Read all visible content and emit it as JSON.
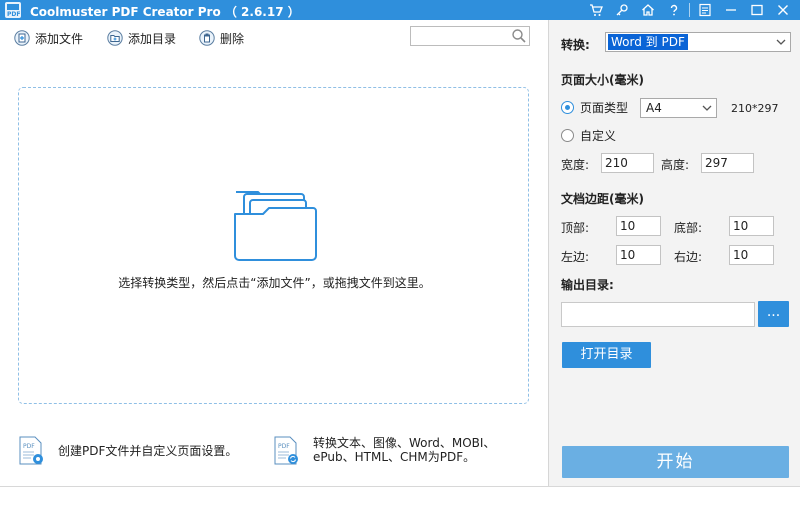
{
  "titlebar": {
    "title": "Coolmuster PDF Creator Pro （ 2.6.17 ）",
    "logo_text": "PDF",
    "icons": [
      "cart-icon",
      "key-icon",
      "home-icon",
      "help-icon",
      "feedback-icon",
      "minimize-icon",
      "maximize-icon",
      "close-icon"
    ]
  },
  "toolbar": {
    "add_file_label": "添加文件",
    "add_folder_label": "添加目录",
    "delete_label": "删除",
    "search_placeholder": ""
  },
  "dropzone": {
    "hint": "选择转换类型，然后点击“添加文件”，或拖拽文件到这里。"
  },
  "features": [
    {
      "icon": "pdf-settings-icon",
      "lines": [
        "创建PDF文件并自定义页面设置。"
      ]
    },
    {
      "icon": "pdf-convert-icon",
      "lines": [
        "转换文本、图像、Word、MOBI、",
        "ePub、HTML、CHM为PDF。"
      ]
    }
  ],
  "panel": {
    "convert_label": "转换:",
    "convert_value": "Word 到 PDF",
    "page_size_heading": "页面大小(毫米)",
    "page_type_label": "页面类型",
    "page_type_value": "A4",
    "page_type_dims": "210*297",
    "custom_label": "自定义",
    "page_type_selected": true,
    "width_label": "宽度:",
    "width_value": "210",
    "height_label": "高度:",
    "height_value": "297",
    "margins_heading": "文档边距(毫米)",
    "top_label": "顶部:",
    "top_value": "10",
    "bottom_label": "底部:",
    "bottom_value": "10",
    "left_label": "左边:",
    "left_value": "10",
    "right_label": "右边:",
    "right_value": "10",
    "output_heading": "输出目录:",
    "output_value": "",
    "browse_label": "...",
    "open_dir_label": "打开目录",
    "start_label": "开始"
  },
  "colors": {
    "accent": "#2f8fdc",
    "start_button": "#6aafe3",
    "dropzone_border": "#8fbfe6",
    "panel_bg": "#f3f3f3"
  }
}
